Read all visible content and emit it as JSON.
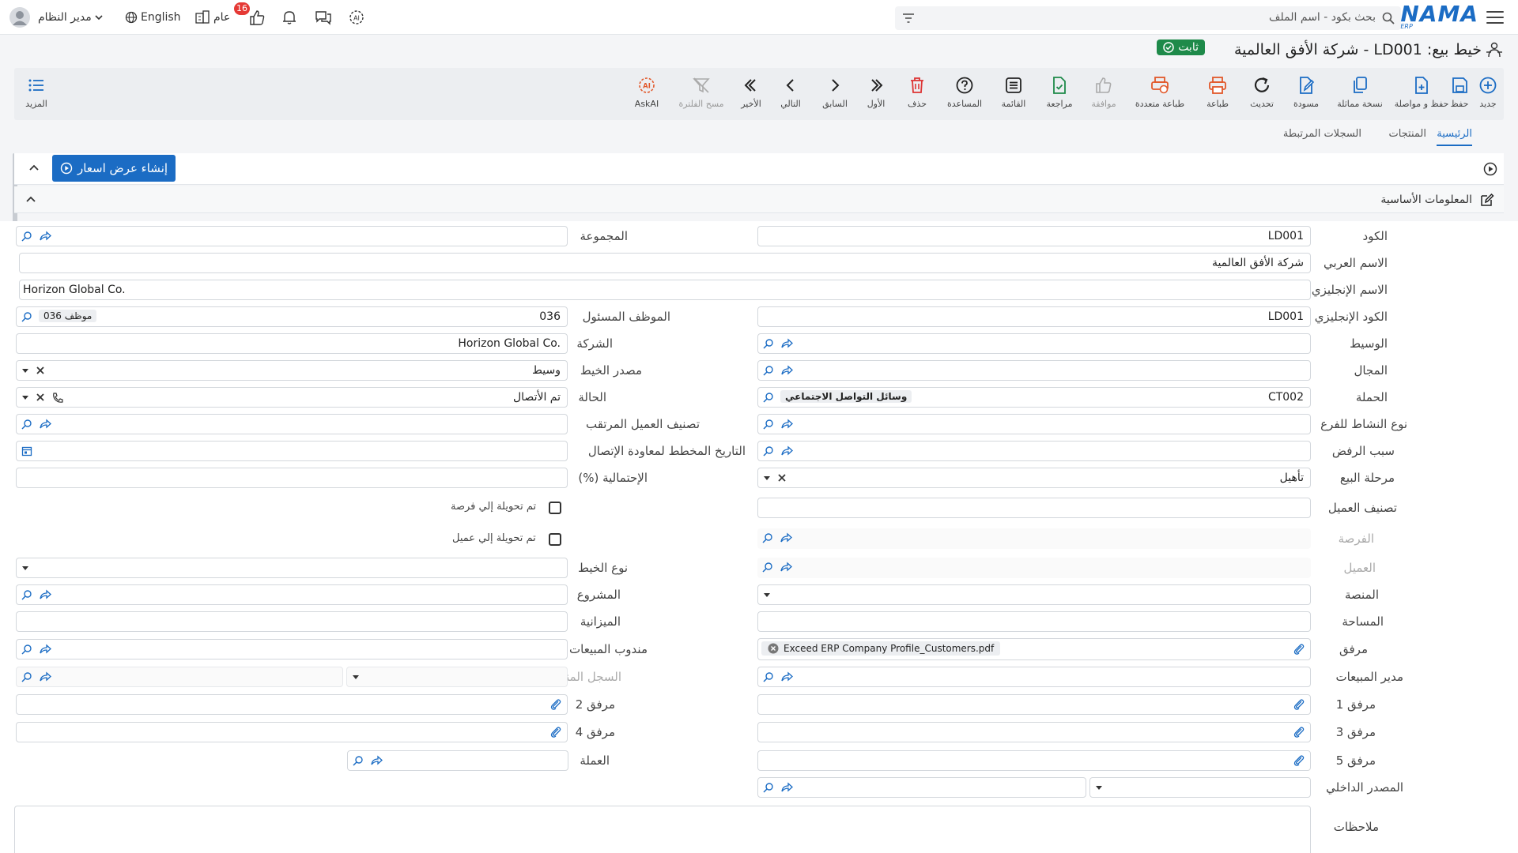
{
  "topbar": {
    "logo": "NAMA",
    "logo_sub": "ERP",
    "search_placeholder": "بحث بكود - اسم الملف",
    "user_name": "مدير النظام",
    "language": "English",
    "general_label": "عام",
    "notifications_count": "16"
  },
  "record": {
    "title": "خيط بيع: LD001 - شركة الأفق العالمية",
    "status": "ثابت"
  },
  "toolbar": {
    "new": "جديد",
    "save": "حفظ",
    "save_continue": "حفظ و مواصلة",
    "copy": "نسخة مماثلة",
    "draft": "مسودة",
    "refresh": "تحديث",
    "print": "طباعة",
    "multi_print": "طباعة متعددة",
    "approve": "موافقة",
    "review": "مراجعة",
    "list": "القائمة",
    "help": "المساعدة",
    "delete": "حذف",
    "first": "الأول",
    "previous": "السابق",
    "next": "التالي",
    "last": "الأخير",
    "clear_filter": "مسح الفلترة",
    "askai": "AskAI",
    "more": "المزيد"
  },
  "tabs": {
    "main": "الرئيسية",
    "products": "المنتجات",
    "related": "السجلات المرتبطة"
  },
  "actions": {
    "create_quote": "إنشاء عرض اسعار"
  },
  "section": {
    "basic_info": "المعلومات الأساسية"
  },
  "form": {
    "code_label": "الكود",
    "code_value": "LD001",
    "group_label": "المجموعة",
    "arabic_name_label": "الاسم العربي",
    "arabic_name_value": "شركة الأفق العالمية",
    "english_name_label": "الاسم الإنجليزي",
    "english_name_value": "Horizon Global Co.",
    "english_code_label": "الكود الإنجليزي",
    "english_code_value": "LD001",
    "employee_label": "الموظف المسئول",
    "employee_value": "036",
    "employee_chip": "موظف 036",
    "broker_label": "الوسيط",
    "company_label": "الشركة",
    "company_value": "Horizon Global Co.",
    "field_label": "المجال",
    "source_label": "مصدر الخيط",
    "source_value": "وسيط",
    "campaign_label": "الحملة",
    "campaign_value": "CT002",
    "campaign_chip": "وسائل التواصل الاجتماعي",
    "status_label": "الحالة",
    "status_value": "تم الأتصال",
    "branch_activity_label": "نوع النشاط للفرع",
    "expected_class_label": "تصنيف العميل المرتقب",
    "reject_reason_label": "سبب الرفض",
    "callback_date_label": "التاريخ المخطط لمعاودة الإتصال",
    "sales_stage_label": "مرحلة البيع",
    "sales_stage_value": "تأهيل",
    "probability_label": "الإحتمالية (%)",
    "customer_class_label": "تصنيف العميل",
    "converted_opportunity_label": "تم تحويلة إلي فرصة",
    "opportunity_label": "الفرصة",
    "converted_customer_label": "تم تحويلة إلي عميل",
    "customer_label": "العميل",
    "lead_type_label": "نوع الخيط",
    "platform_label": "المنصة",
    "project_label": "المشروع",
    "area_label": "المساحة",
    "budget_label": "الميزانية",
    "attachment_label": "مرفق",
    "attachment_file": "Exceed ERP Company Profile_Customers.pdf",
    "sales_rep_label": "مندوب المبيعات",
    "sales_manager_label": "مدير المبيعات",
    "origin_record_label": "السجل المنشأ",
    "attachment1_label": "مرفق 1",
    "attachment2_label": "مرفق 2",
    "attachment3_label": "مرفق 3",
    "attachment4_label": "مرفق 4",
    "attachment5_label": "مرفق 5",
    "currency_label": "العملة",
    "internal_source_label": "المصدر الداخلي",
    "notes_label": "ملاحظات"
  },
  "colors": {
    "primary": "#1b6cc4",
    "success": "#1e8a4a",
    "danger": "#e53935"
  }
}
